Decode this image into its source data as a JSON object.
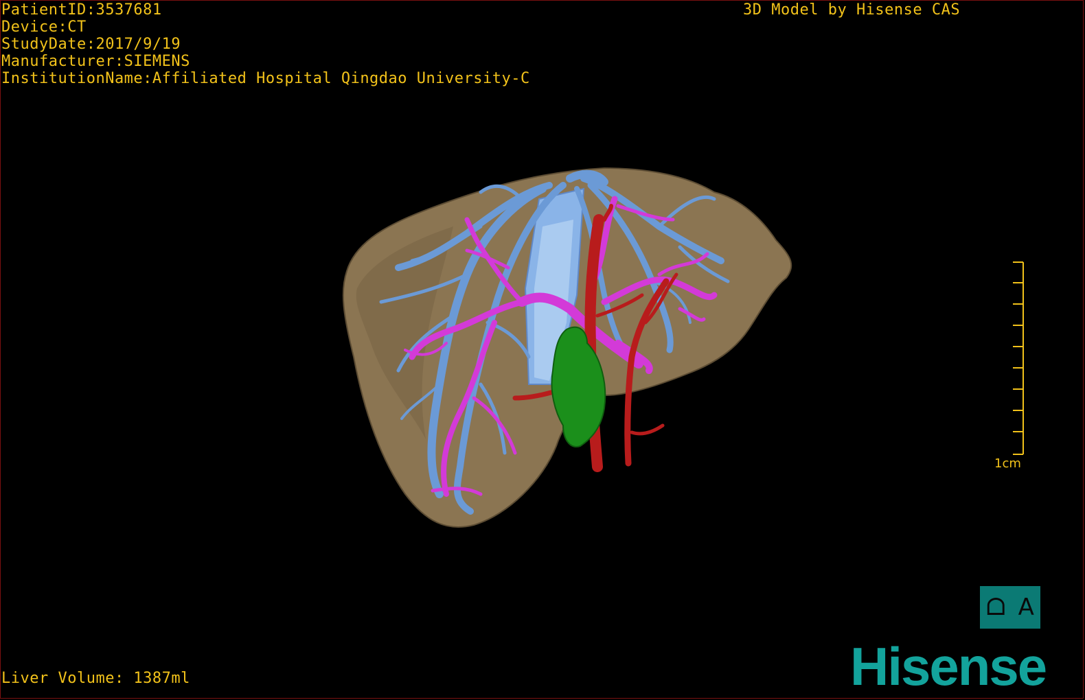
{
  "info": {
    "patient_id": "PatientID:3537681",
    "device": "Device:CT",
    "study_date": "StudyDate:2017/9/19",
    "manufacturer": "Manufacturer:SIEMENS",
    "institution": "InstitutionName:Affiliated Hospital Qingdao University-C"
  },
  "brand_top": "3D Model by Hisense CAS",
  "volume": "Liver Volume: 1387ml",
  "scale_label": "1cm",
  "view_button": {
    "left_glyph": "ᗝ",
    "right_glyph": "A"
  },
  "logo": "Hisense",
  "colors": {
    "text": "#f2c21a",
    "liver": "#8b7552",
    "hepatic_vein": "#6b9ad6",
    "portal_vein": "#d33ad8",
    "artery": "#b81c1c",
    "gallbladder": "#1b8f1b",
    "logo": "#13a39c"
  }
}
